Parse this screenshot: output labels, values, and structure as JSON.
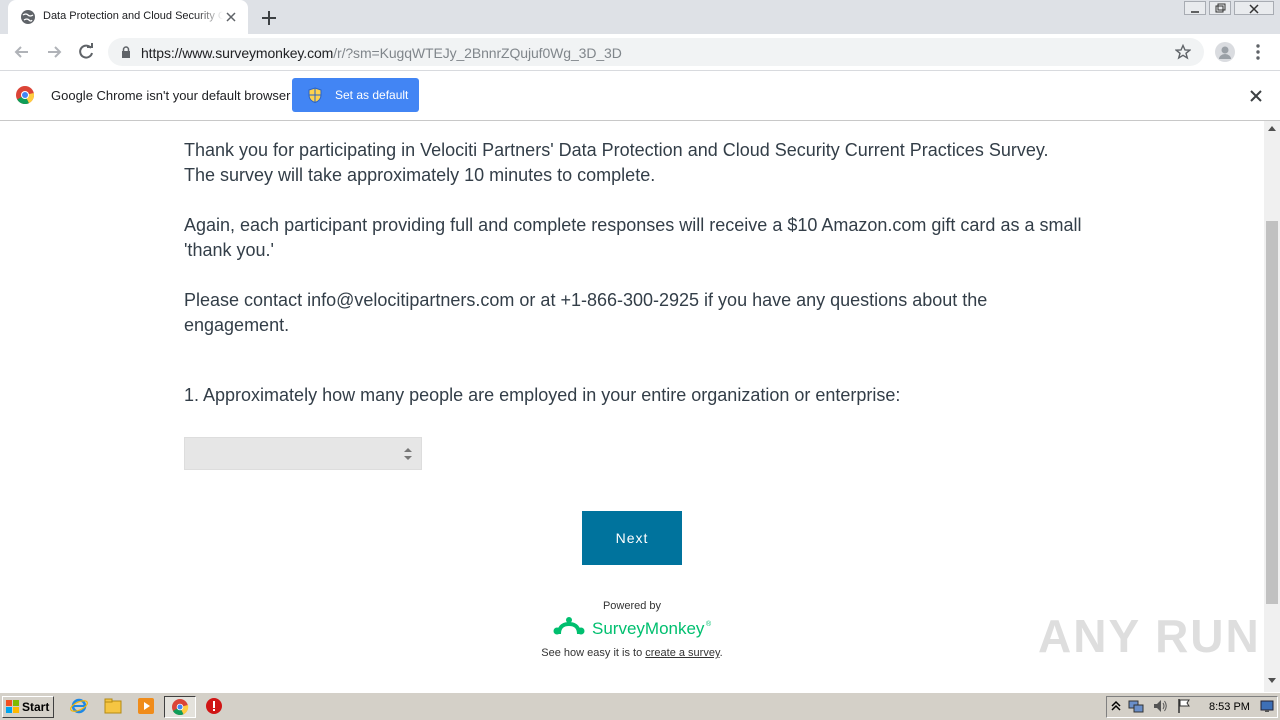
{
  "browser": {
    "tab": {
      "title": "Data Protection and Cloud Security Current Practices Survey"
    },
    "url": {
      "host": "https://www.surveymonkey.com",
      "path": "/r/?sm=KugqWTEJy_2BnnrZQujuf0Wg_3D_3D"
    }
  },
  "infobar": {
    "message": "Google Chrome isn't your default browser",
    "button_label": "Set as default"
  },
  "survey": {
    "intro": [
      "Thank you for participating in Velociti Partners' Data Protection and Cloud Security Current Practices Survey.  The survey will take approximately 10 minutes to complete.",
      "Again, each participant providing full and complete responses will receive a $10 Amazon.com gift card as a small 'thank you.'",
      "Please contact info@velocitipartners.com or at +1-866-300-2925 if you have any questions about the engagement."
    ],
    "question_1": "1. Approximately how many people are employed in your entire organization or enterprise:",
    "dropdown_value": "",
    "next_label": "Next",
    "footer": {
      "powered_by": "Powered by",
      "brand": "SurveyMonkey",
      "tm": "®",
      "see_how": "See how easy it is to ",
      "link": "create a survey",
      "period": "."
    }
  },
  "watermark": "ANY RUN",
  "taskbar": {
    "start_label": "Start",
    "clock": "8:53 PM"
  },
  "colors": {
    "accent_button": "#00739d",
    "brand_green": "#00bf6f",
    "chrome_blue": "#4285f4"
  }
}
